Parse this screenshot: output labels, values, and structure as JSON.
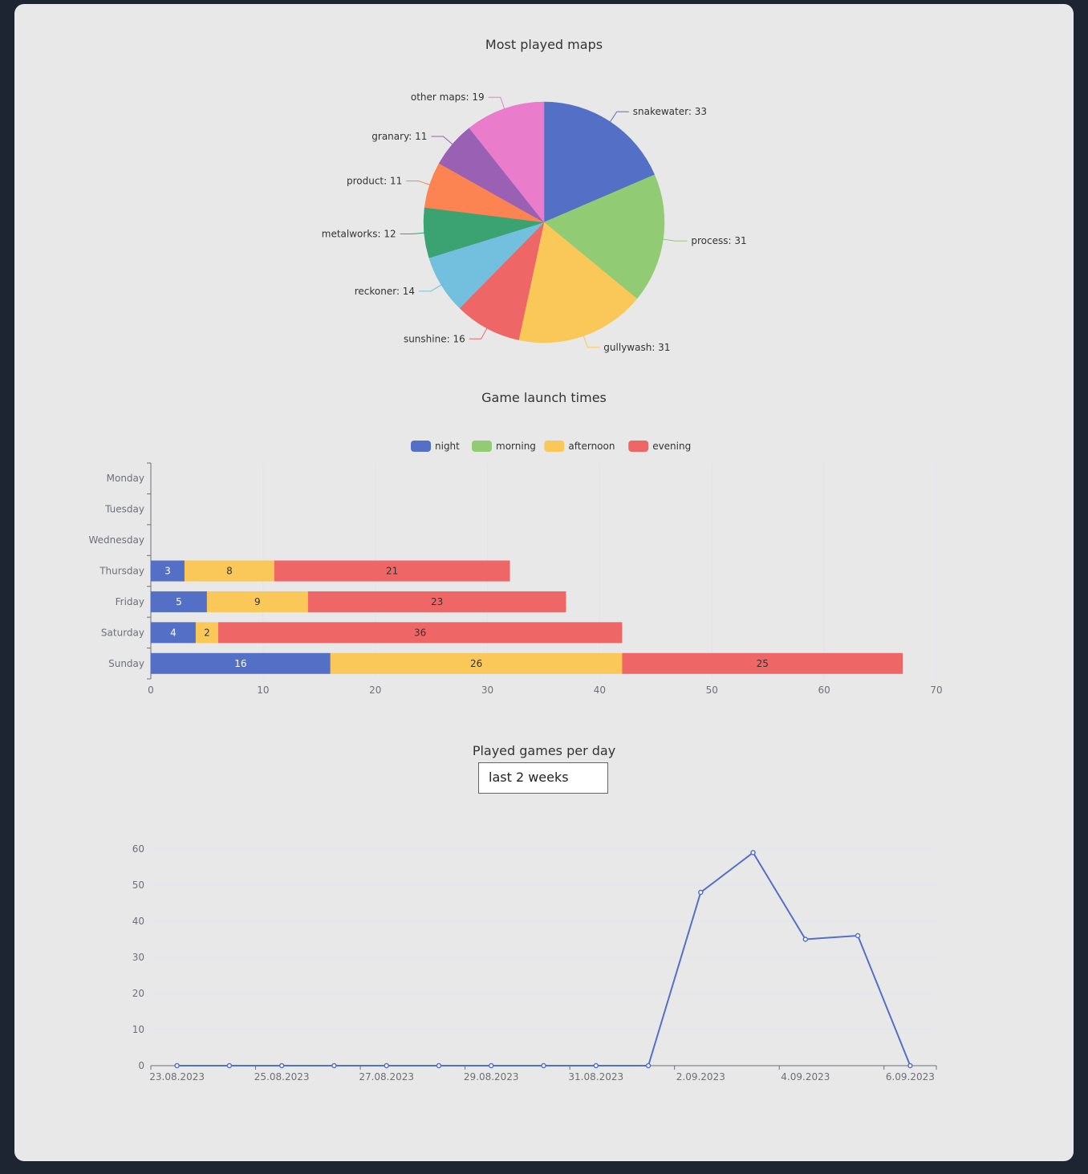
{
  "chart_data": [
    {
      "type": "pie",
      "title": "Most played maps",
      "slices": [
        {
          "label": "snakewater",
          "value": 33,
          "color": "#5470c6"
        },
        {
          "label": "process",
          "value": 31,
          "color": "#91cc75"
        },
        {
          "label": "gullywash",
          "value": 31,
          "color": "#fac858"
        },
        {
          "label": "sunshine",
          "value": 16,
          "color": "#ee6666"
        },
        {
          "label": "reckoner",
          "value": 14,
          "color": "#73c0de"
        },
        {
          "label": "metalworks",
          "value": 12,
          "color": "#3ba272"
        },
        {
          "label": "product",
          "value": 11,
          "color": "#fc8452"
        },
        {
          "label": "granary",
          "value": 11,
          "color": "#9a60b4"
        },
        {
          "label": "other maps",
          "value": 19,
          "color": "#ea7ccc"
        }
      ]
    },
    {
      "type": "bar",
      "orientation": "horizontal",
      "stacked": true,
      "title": "Game launch times",
      "legend_position": "top",
      "categories": [
        "Monday",
        "Tuesday",
        "Wednesday",
        "Thursday",
        "Friday",
        "Saturday",
        "Sunday"
      ],
      "series": [
        {
          "name": "night",
          "color": "#5470c6",
          "values": [
            0,
            0,
            0,
            3,
            5,
            4,
            16
          ]
        },
        {
          "name": "morning",
          "color": "#91cc75",
          "values": [
            0,
            0,
            0,
            0,
            0,
            0,
            0
          ]
        },
        {
          "name": "afternoon",
          "color": "#fac858",
          "values": [
            0,
            0,
            0,
            8,
            9,
            2,
            26
          ]
        },
        {
          "name": "evening",
          "color": "#ee6666",
          "values": [
            0,
            0,
            0,
            21,
            23,
            36,
            25
          ]
        }
      ],
      "xlim": [
        0,
        70
      ],
      "xticks": [
        "0",
        "10",
        "20",
        "30",
        "40",
        "50",
        "60",
        "70"
      ],
      "grid": true
    },
    {
      "type": "line",
      "title": "Played games per day",
      "x": [
        "23.08.2023",
        "24.08.2023",
        "25.08.2023",
        "26.08.2023",
        "27.08.2023",
        "28.08.2023",
        "29.08.2023",
        "30.08.2023",
        "31.08.2023",
        "1.09.2023",
        "2.09.2023",
        "3.09.2023",
        "4.09.2023",
        "5.09.2023",
        "6.09.2023"
      ],
      "xtick_labels": [
        "23.08.2023",
        "25.08.2023",
        "27.08.2023",
        "29.08.2023",
        "31.08.2023",
        "2.09.2023",
        "4.09.2023",
        "6.09.2023"
      ],
      "values": [
        0,
        0,
        0,
        0,
        0,
        0,
        0,
        0,
        0,
        0,
        48,
        59,
        35,
        36,
        0
      ],
      "color": "#5470c6",
      "ylim": [
        0,
        60
      ],
      "yticks": [
        "0",
        "10",
        "20",
        "30",
        "40",
        "50",
        "60"
      ],
      "grid": true
    }
  ],
  "filter": {
    "selected": "last 2 weeks"
  }
}
